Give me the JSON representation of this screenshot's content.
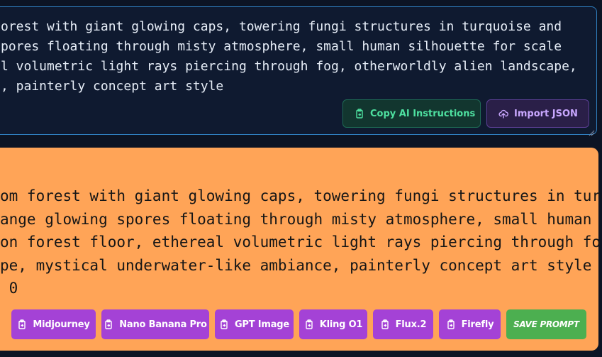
{
  "editor": {
    "prompt_lines": [
      "orest with giant glowing caps, towering fungi structures in turquoise and",
      "pores floating through misty atmosphere, small human silhouette for scale",
      "l volumetric light rays piercing through fog, otherworldly alien landscape,",
      ", painterly concept art style"
    ],
    "copy_ai_instructions_label": "Copy AI Instructions",
    "import_json_label": "Import JSON"
  },
  "result": {
    "prompt_lines": [
      "om forest with giant glowing caps, towering fungi structures in turq",
      "ange glowing spores floating through misty atmosphere, small human s",
      "on forest floor, ethereal volumetric light rays piercing through fo",
      "pe, mystical underwater-like ambiance, painterly concept art style -",
      " 0"
    ]
  },
  "generators": [
    {
      "label": "Midjourney"
    },
    {
      "label": "Nano Banana Pro"
    },
    {
      "label": "GPT Image"
    },
    {
      "label": "Kling O1"
    },
    {
      "label": "Flux.2"
    },
    {
      "label": "Firefly"
    }
  ],
  "save_label": "SAVE PROMPT",
  "colors": {
    "background": "#0c1424",
    "editor_border": "#2f7fbf",
    "copy_accent": "#4ee0a0",
    "import_accent": "#c9a8ff",
    "result_card": "#ffa457",
    "generator_button": "#a442d6",
    "save_button": "#4caf50"
  },
  "icons": {
    "copy": "clipboard-copy-icon",
    "import": "cloud-upload-icon",
    "generator": "clipboard-copy-icon"
  }
}
